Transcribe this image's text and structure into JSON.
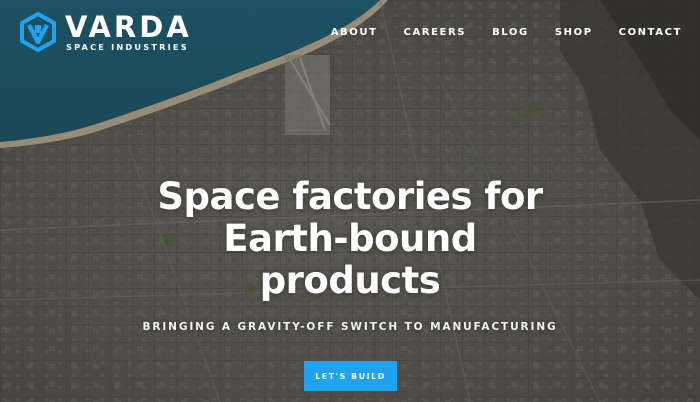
{
  "brand": {
    "name": "VARDA",
    "subtitle": "SPACE INDUSTRIES",
    "icon": "hexagon-v-logo-icon",
    "accent_color": "#1fa3ef"
  },
  "nav": {
    "items": [
      {
        "label": "ABOUT"
      },
      {
        "label": "CAREERS"
      },
      {
        "label": "BLOG"
      },
      {
        "label": "SHOP"
      },
      {
        "label": "CONTACT"
      }
    ]
  },
  "hero": {
    "headline_lines": [
      "Space factories for",
      "Earth-bound",
      "products"
    ],
    "tagline": "BRINGING A GRAVITY-OFF SWITCH TO MANUFACTURING",
    "cta_label": "LET'S BUILD",
    "background": "satellite-map-image"
  },
  "colors": {
    "ocean": "#1f5a6f",
    "land": "#5e5c57",
    "cta": "#1fa3ef"
  }
}
